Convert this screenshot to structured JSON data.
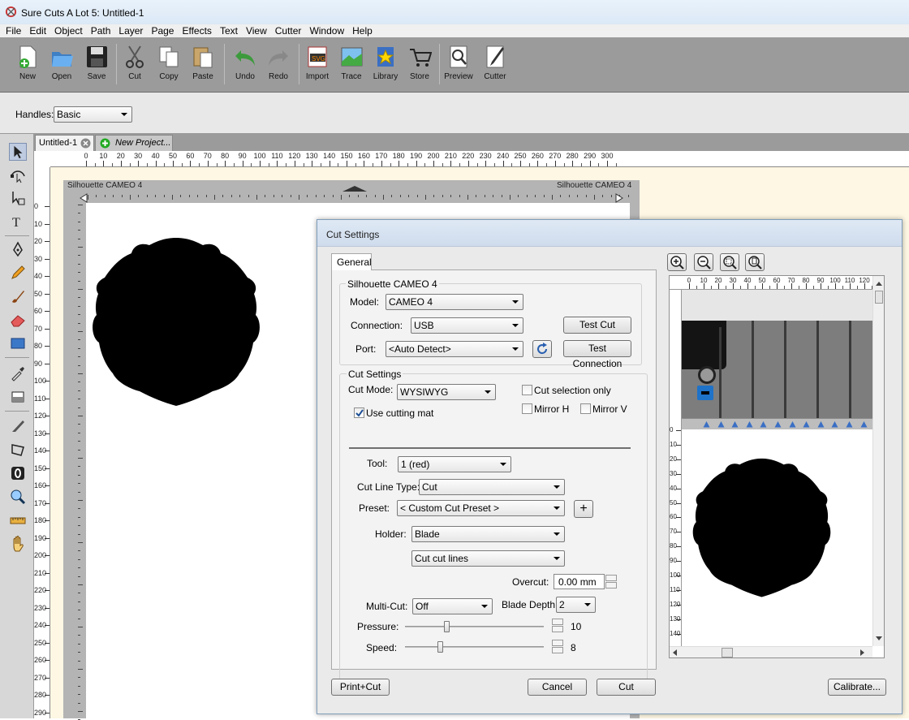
{
  "window": {
    "title": "Sure Cuts A Lot 5: Untitled-1"
  },
  "menu": [
    "File",
    "Edit",
    "Object",
    "Path",
    "Layer",
    "Page",
    "Effects",
    "Text",
    "View",
    "Cutter",
    "Window",
    "Help"
  ],
  "toolbar": {
    "new": "New",
    "open": "Open",
    "save": "Save",
    "cut": "Cut",
    "copy": "Copy",
    "paste": "Paste",
    "undo": "Undo",
    "redo": "Redo",
    "import": "Import",
    "trace": "Trace",
    "library": "Library",
    "store": "Store",
    "preview": "Preview",
    "cutter": "Cutter"
  },
  "handles": {
    "label": "Handles:",
    "value": "Basic"
  },
  "tabs": {
    "doc": "Untitled-1",
    "new_project": "New Project..."
  },
  "hruler": [
    "0",
    "10",
    "20",
    "30",
    "40",
    "50",
    "60",
    "70",
    "80",
    "90",
    "100",
    "110",
    "120",
    "130",
    "140",
    "150",
    "160",
    "170",
    "180",
    "190",
    "200",
    "210",
    "220",
    "230",
    "240",
    "250",
    "260",
    "270",
    "280",
    "290",
    "300"
  ],
  "vruler": [
    "0",
    "10",
    "20",
    "30",
    "40",
    "50",
    "60",
    "70",
    "80",
    "90",
    "100",
    "110",
    "120",
    "130",
    "140",
    "150",
    "160",
    "170",
    "180",
    "190",
    "200",
    "210",
    "220",
    "230",
    "240",
    "250",
    "260",
    "270",
    "280",
    "290"
  ],
  "mat": {
    "label_left": "Silhouette CAMEO 4",
    "label_right": "Silhouette CAMEO 4"
  },
  "dialog": {
    "title": "Cut Settings",
    "tab_general": "General",
    "device_group": "Silhouette CAMEO 4",
    "model_label": "Model:",
    "model_value": "CAMEO 4",
    "connection_label": "Connection:",
    "connection_value": "USB",
    "port_label": "Port:",
    "port_value": "<Auto Detect>",
    "test_cut": "Test Cut",
    "test_connection": "Test Connection",
    "cut_settings_group": "Cut Settings",
    "cut_mode_label": "Cut Mode:",
    "cut_mode_value": "WYSIWYG",
    "cut_selection_only": "Cut selection only",
    "mirror_h": "Mirror H",
    "mirror_v": "Mirror V",
    "use_cutting_mat": "Use cutting mat",
    "tool_label": "Tool:",
    "tool_value": "1 (red)",
    "cut_line_type_label": "Cut Line Type:",
    "cut_line_type_value": "Cut",
    "preset_label": "Preset:",
    "preset_value": "< Custom Cut Preset >",
    "holder_label": "Holder:",
    "holder_value": "Blade",
    "cut_lines_value": "Cut cut lines",
    "overcut_label": "Overcut:",
    "overcut_value": "0.00 mm",
    "multicut_label": "Multi-Cut:",
    "multicut_value": "Off",
    "blade_depth_label": "Blade Depth:",
    "blade_depth_value": "2",
    "pressure_label": "Pressure:",
    "pressure_value": "10",
    "pressure_level": 0.3,
    "speed_label": "Speed:",
    "speed_value": "8",
    "speed_level": 0.25,
    "print_cut": "Print+Cut",
    "cancel": "Cancel",
    "cut": "Cut",
    "calibrate": "Calibrate...",
    "preview_hruler": [
      "0",
      "10",
      "20",
      "30",
      "40",
      "50",
      "60",
      "70",
      "80",
      "90",
      "100",
      "110",
      "120"
    ],
    "preview_vruler": [
      "0",
      "10",
      "20",
      "30",
      "40",
      "50",
      "60",
      "70",
      "80",
      "90",
      "100",
      "110",
      "120",
      "130",
      "140"
    ],
    "use_cutting_mat_checked": true,
    "cut_selection_only_checked": false,
    "mirror_h_checked": false,
    "mirror_v_checked": false
  }
}
